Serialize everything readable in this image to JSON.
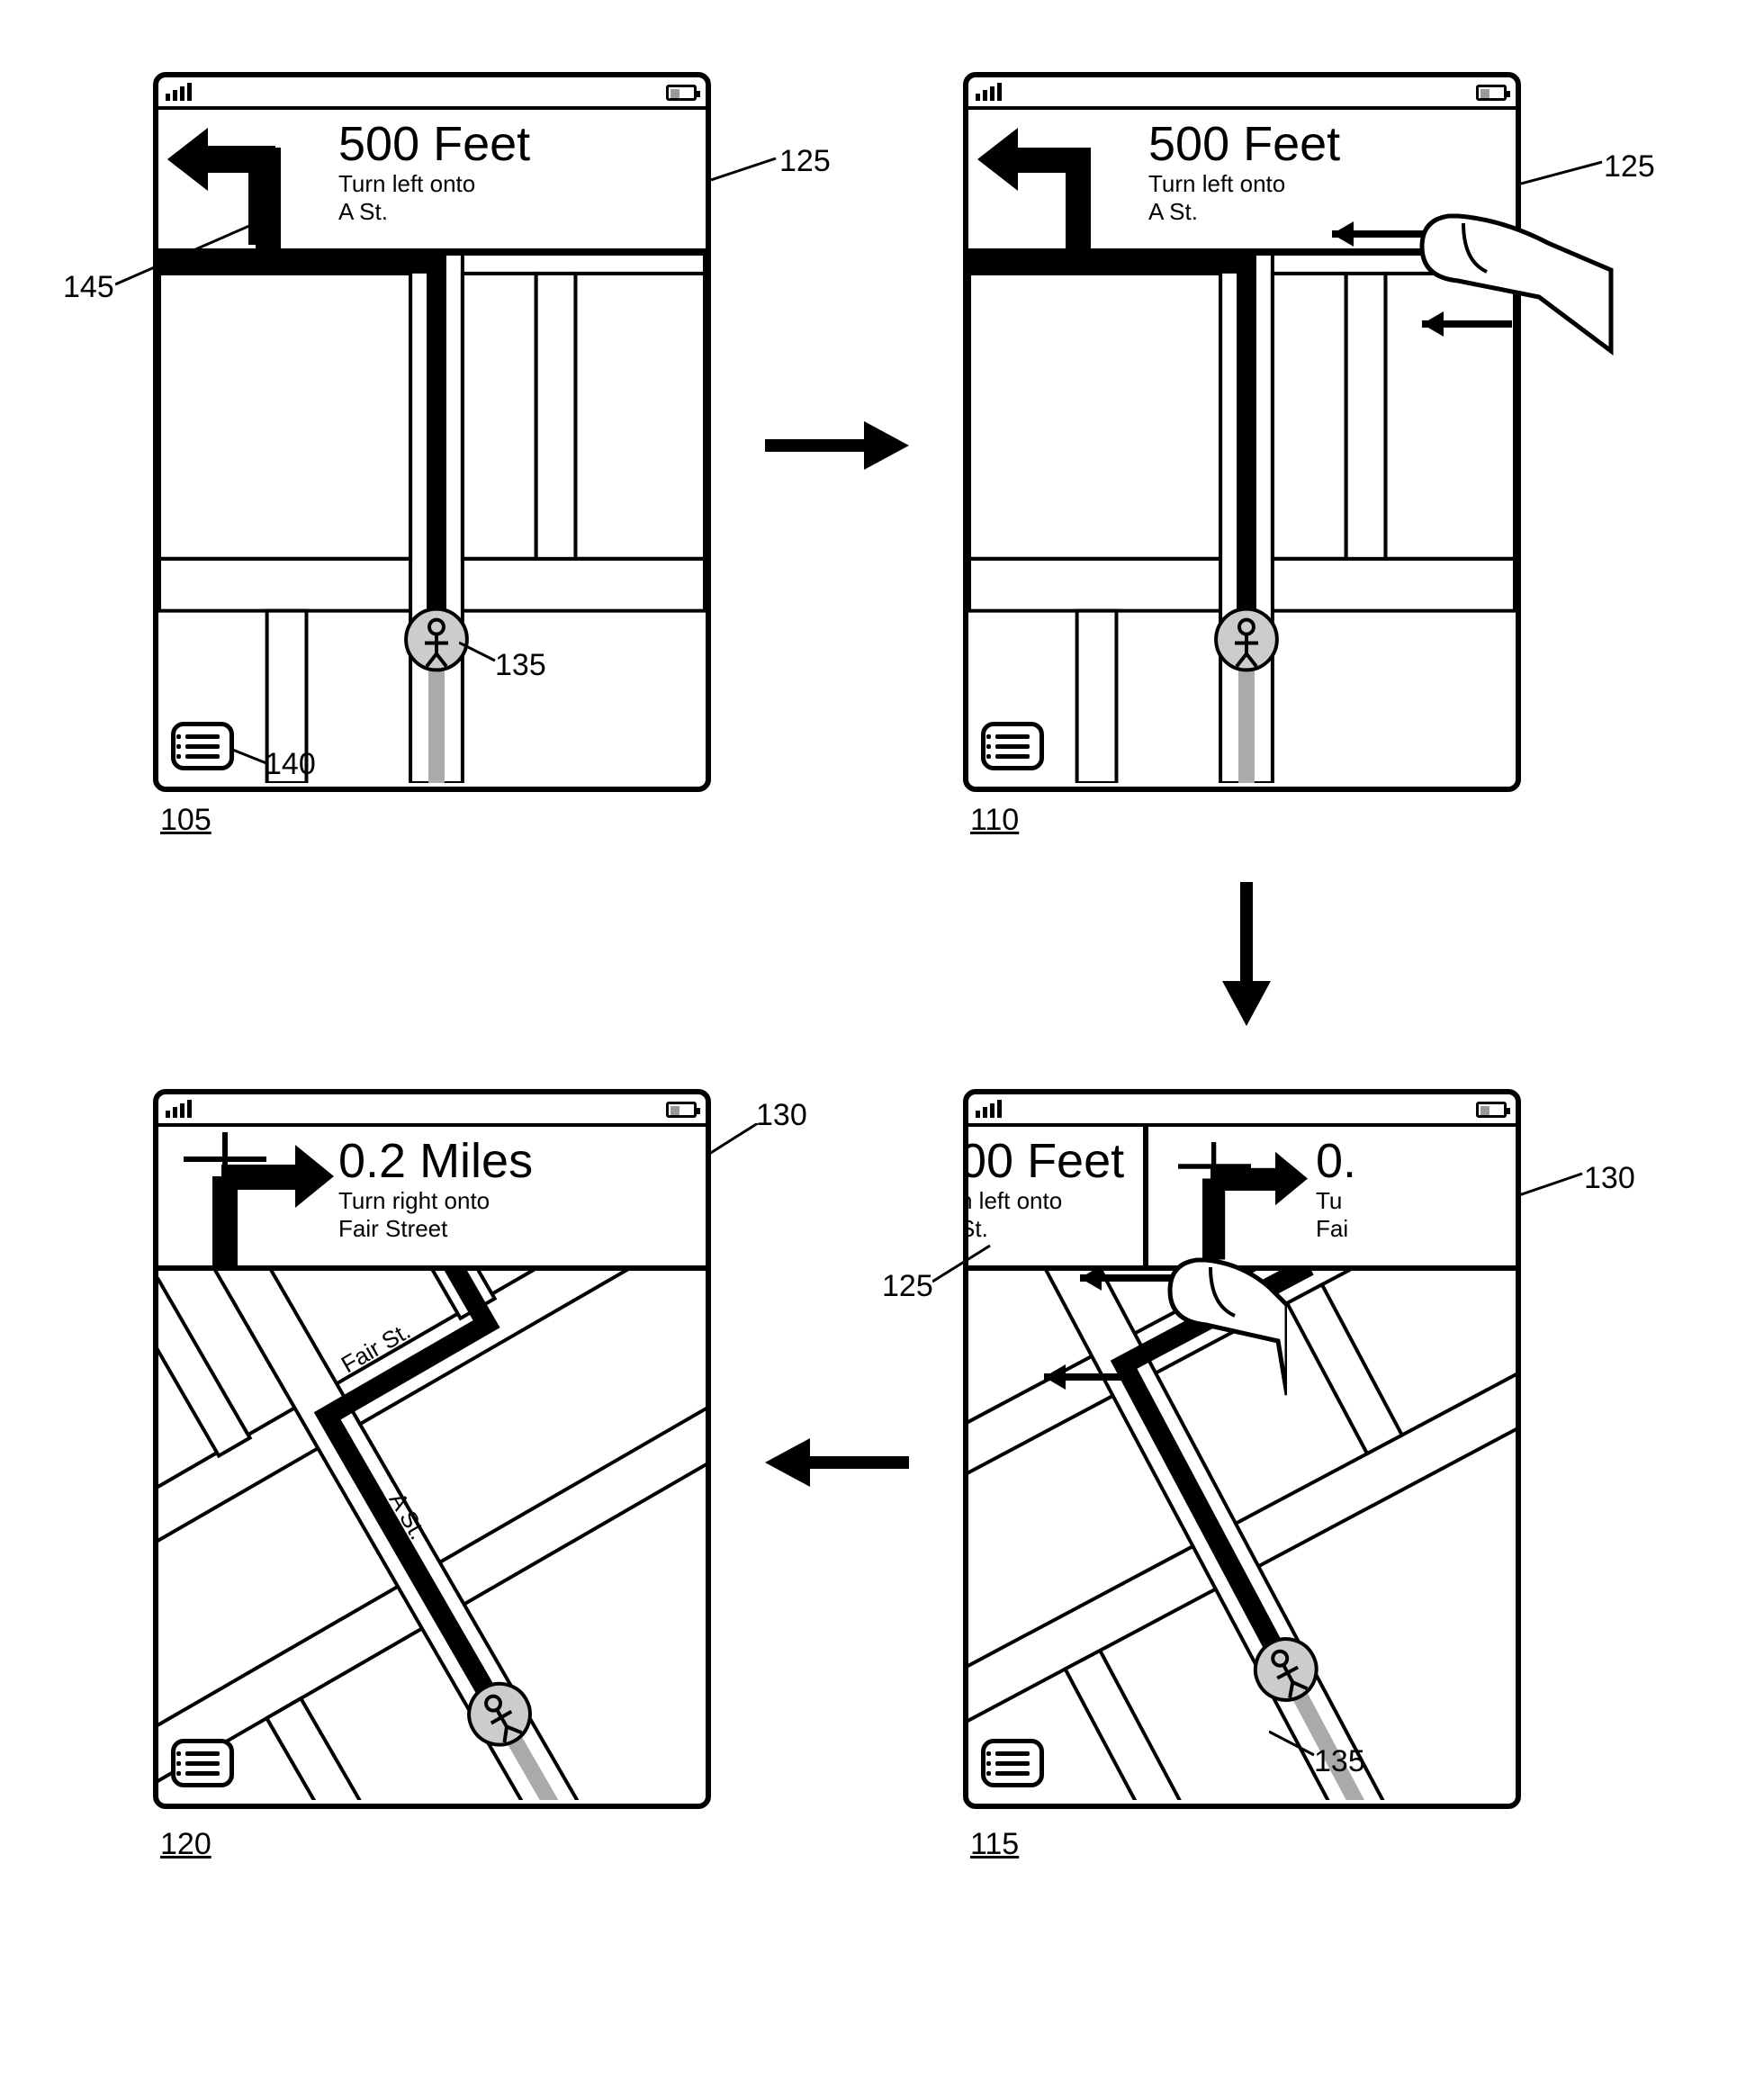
{
  "stages": {
    "s105": {
      "banner": {
        "distance": "500 Feet",
        "line1": "Turn left onto",
        "line2": "A St."
      },
      "label": "105"
    },
    "s110": {
      "banner": {
        "distance": "500 Feet",
        "line1": "Turn left onto",
        "line2": "A St."
      },
      "label": "110"
    },
    "s115": {
      "left": {
        "distance_frag": "00 Feet",
        "line1_frag": "n left onto",
        "line2_frag": "St."
      },
      "right": {
        "distance_frag": "0.",
        "line1_frag": "Tu",
        "line2_frag": "Fai"
      },
      "label": "115"
    },
    "s120": {
      "banner": {
        "distance": "0.2 Miles",
        "line1": "Turn right onto",
        "line2": "Fair Street"
      },
      "label": "120",
      "street1": "Fair St.",
      "street2": "A St."
    }
  },
  "callouts": {
    "c125": "125",
    "c130": "130",
    "c135": "135",
    "c140": "140",
    "c145": "145"
  }
}
